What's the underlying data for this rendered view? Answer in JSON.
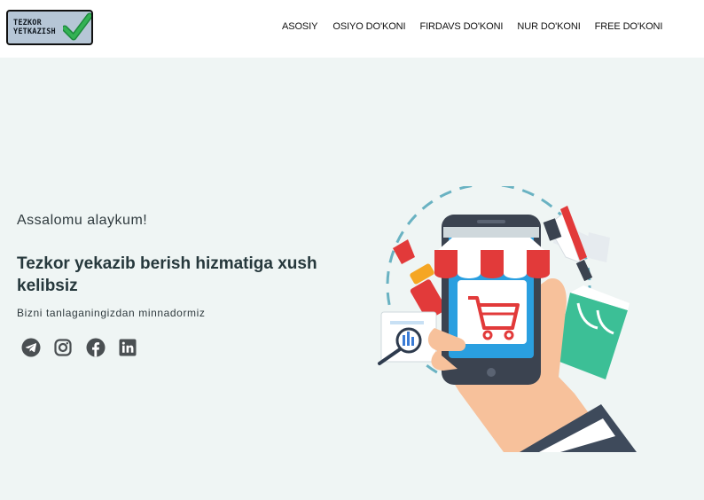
{
  "header": {
    "logo_text_line1": "TEZKOR",
    "logo_text_line2": "YETKAZISH",
    "nav": [
      "ASOSIY",
      "OSIYO DO'KONI",
      "FIRDAVS DO'KONI",
      "NUR DO'KONI",
      "FREE DO'KONI"
    ]
  },
  "hero": {
    "greeting": "Assalomu alaykum!",
    "title": "Tezkor yekazib berish hizmatiga xush kelibsiz",
    "subtitle": "Bizni tanlaganingizdan minnadormiz"
  },
  "social_icons": [
    "telegram-icon",
    "instagram-icon",
    "facebook-icon",
    "linkedin-icon"
  ],
  "colors": {
    "background": "#eff5f4",
    "text_dark": "#26383c",
    "icon_gray": "#4a4f52",
    "check_green": "#2fa84f"
  }
}
